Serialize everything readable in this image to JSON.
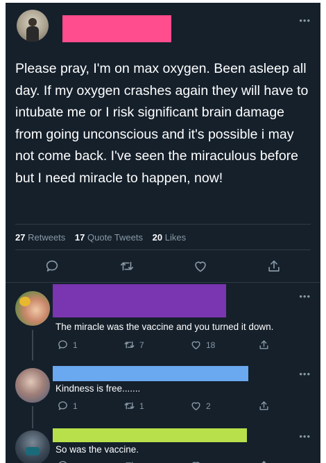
{
  "colors": {
    "background": "#15202b",
    "redact_main": "#ff4d8d",
    "redact_reply1": "#7a35b0",
    "redact_reply2": "#6aa8ef",
    "redact_reply3": "#b7e04a"
  },
  "tweet": {
    "text": "Please pray, I'm on max oxygen. Been asleep all day. If my oxygen crashes again they will have to intubate me or I risk significant brain damage from going unconscious and it's possible i may not come back. I've seen the miraculous before but I need miracle to happen, now!",
    "retweets_count": "27",
    "retweets_label": "Retweets",
    "quote_count": "17",
    "quote_label": "Quote Tweets",
    "likes_count": "20",
    "likes_label": "Likes"
  },
  "replies": [
    {
      "text": "The miracle was the vaccine and you turned it down.",
      "reply_count": "1",
      "retweet_count": "7",
      "like_count": "18"
    },
    {
      "text": "Kindness is free.......",
      "reply_count": "1",
      "retweet_count": "1",
      "like_count": "2"
    },
    {
      "text": "So was the vaccine."
    }
  ],
  "icons": [
    "reply-icon",
    "retweet-icon",
    "like-icon",
    "share-icon",
    "more-icon"
  ],
  "more_glyph": "•••"
}
